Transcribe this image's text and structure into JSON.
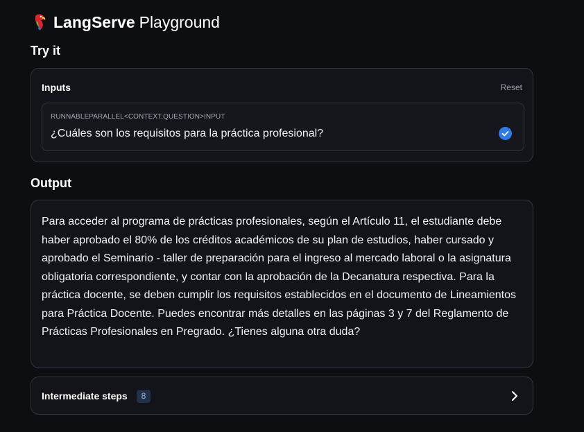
{
  "header": {
    "brand": "LangServe",
    "suffix": "Playground",
    "logo_icon": "parrot-icon"
  },
  "try_it": {
    "title": "Try it",
    "inputs_label": "Inputs",
    "reset_label": "Reset",
    "input_type": "RUNNABLEPARALLEL<CONTEXT,QUESTION>INPUT",
    "input_value": "¿Cuáles son los requisitos para la práctica profesional?",
    "status_icon": "check-circle-icon"
  },
  "output": {
    "title": "Output",
    "text": "Para acceder al programa de prácticas profesionales, según el Artículo 11, el estudiante debe haber aprobado el 80% de los créditos académicos de su plan de estudios, haber cursado y aprobado el Seminario - taller de preparación para el ingreso al mercado laboral o la asignatura obligatoria correspondiente, y contar con la aprobación de la Decanatura respectiva. Para la práctica docente, se deben cumplir los requisitos establecidos en el documento de Lineamientos para Práctica Docente. Puedes encontrar más detalles en las páginas 3 y 7 del Reglamento de Prácticas Profesionales en Pregrado. ¿Tienes alguna otra duda?"
  },
  "intermediate_steps": {
    "label": "Intermediate steps",
    "count": "8",
    "expand_icon": "chevron-right-icon"
  },
  "colors": {
    "background": "#0d0e12",
    "card": "#131419",
    "border": "#34363f",
    "accent": "#2f7ae5"
  }
}
